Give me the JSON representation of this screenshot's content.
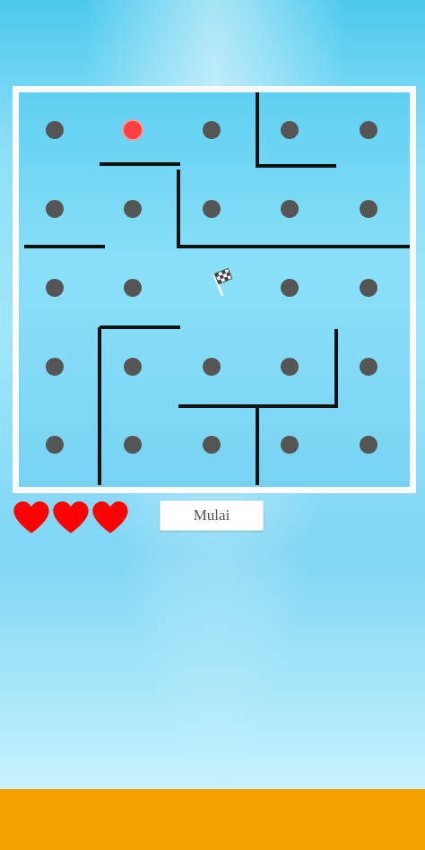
{
  "game": {
    "colors": {
      "wall": "#111111",
      "dot": "#555555",
      "active_dot": "#ff4040",
      "board_border": "#ffffff",
      "heart": "#ff0000",
      "ground": "#f5a200"
    },
    "grid": {
      "rows": 5,
      "cols": 5
    },
    "active_dot": {
      "row": 0,
      "col": 1
    },
    "finish_flag_icon": "checkered-flag-icon",
    "lives": 3,
    "start_button_label": "Mulai"
  }
}
